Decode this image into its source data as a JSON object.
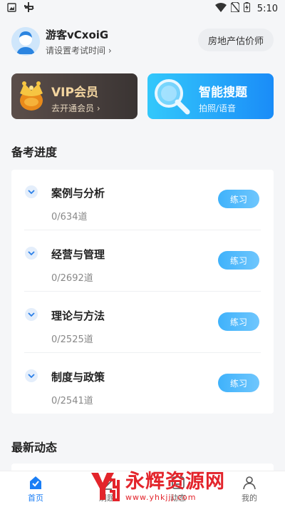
{
  "status_bar": {
    "time": "5:10"
  },
  "profile": {
    "username": "游客vCxoiG",
    "subtitle": "请设置考试时间",
    "exam_button": "房地产估价师"
  },
  "promo_cards": {
    "vip": {
      "title": "VIP会员",
      "subtitle": "去开通会员"
    },
    "search": {
      "title": "智能搜题",
      "subtitle": "拍照/语音"
    }
  },
  "progress_section": {
    "title": "备考进度",
    "subjects": [
      {
        "name": "案例与分析",
        "count": "0/634道",
        "button": "练习"
      },
      {
        "name": "经营与管理",
        "count": "0/2692道",
        "button": "练习"
      },
      {
        "name": "理论与方法",
        "count": "0/2525道",
        "button": "练习"
      },
      {
        "name": "制度与政策",
        "count": "0/2541道",
        "button": "练习"
      }
    ]
  },
  "news_section": {
    "title": "最新动态"
  },
  "tabbar": {
    "items": [
      {
        "label": "首页",
        "icon": "home-icon",
        "active": true
      },
      {
        "label": "刷题",
        "icon": "pen-icon",
        "active": false
      },
      {
        "label": "动态",
        "icon": "news-icon",
        "active": false
      },
      {
        "label": "我的",
        "icon": "user-icon",
        "active": false
      }
    ]
  },
  "watermark": {
    "title": "永辉资源网",
    "url": "www.yhkjjj.com"
  },
  "colors": {
    "accent": "#1a7ef5",
    "vip_gold": "#f3d5a0",
    "watermark_red": "#e3242b"
  }
}
